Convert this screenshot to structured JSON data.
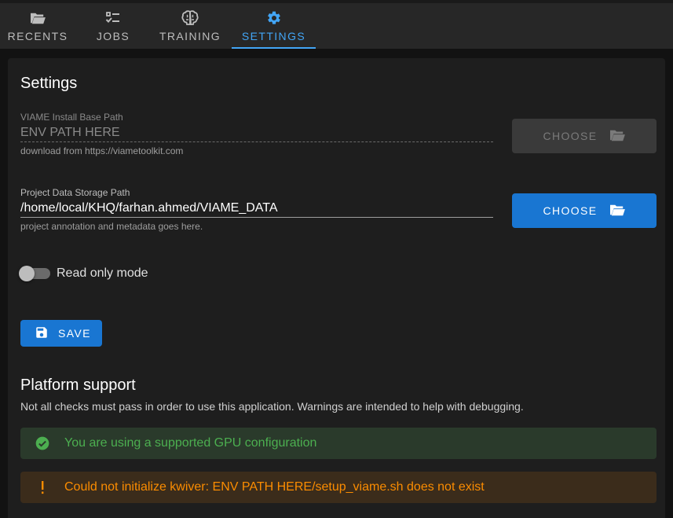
{
  "nav": {
    "tabs": [
      {
        "label": "RECENTS",
        "icon": "folder-open-icon"
      },
      {
        "label": "JOBS",
        "icon": "checklist-icon"
      },
      {
        "label": "TRAINING",
        "icon": "brain-icon"
      },
      {
        "label": "SETTINGS",
        "icon": "gear-icon"
      }
    ],
    "active_tab": "SETTINGS"
  },
  "settings": {
    "title": "Settings",
    "install_path": {
      "label": "VIAME Install Base Path",
      "value": "ENV PATH HERE",
      "hint": "download from https://viametoolkit.com",
      "button": "CHOOSE"
    },
    "data_path": {
      "label": "Project Data Storage Path",
      "value": "/home/local/KHQ/farhan.ahmed/VIAME_DATA",
      "hint": "project annotation and metadata goes here.",
      "button": "CHOOSE"
    },
    "read_only": {
      "label": "Read only mode",
      "enabled": false
    },
    "save_label": "SAVE"
  },
  "platform": {
    "title": "Platform support",
    "description": "Not all checks must pass in order to use this application. Warnings are intended to help with debugging.",
    "checks": [
      {
        "status": "success",
        "message": "You are using a supported GPU configuration"
      },
      {
        "status": "warning",
        "message": "Could not initialize kwiver: ENV PATH HERE/setup_viame.sh does not exist"
      }
    ]
  },
  "colors": {
    "accent": "#42a5f5",
    "primary_button": "#1976d2",
    "success": "#4caf50",
    "warning": "#fb8c00"
  }
}
